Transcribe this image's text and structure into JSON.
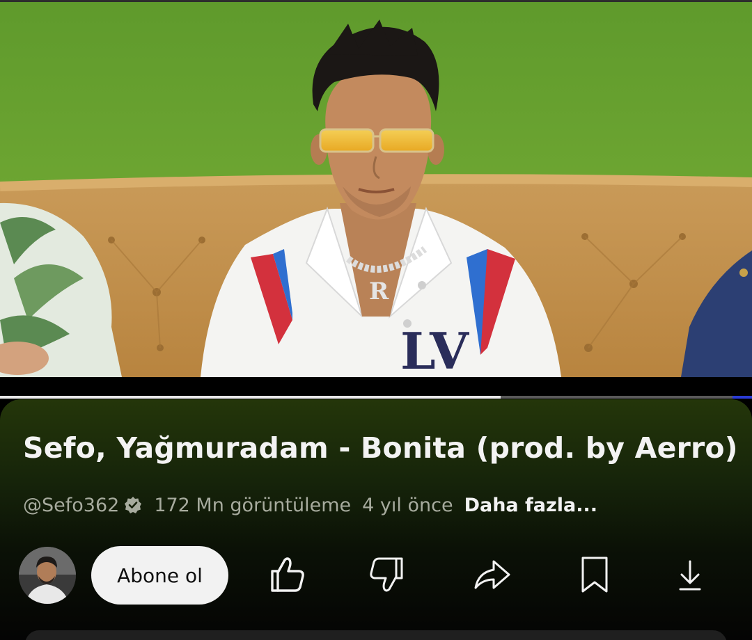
{
  "video": {
    "progress": 0.666
  },
  "title": "Sefo, Yağmuradam - Bonita (prod. by Aerro)",
  "meta": {
    "channel_handle": "@Sefo362",
    "views": "172 Mn görüntüleme",
    "age": "4 yıl önce",
    "more_label": "Daha fazla..."
  },
  "actions": {
    "subscribe_label": "Abone ol",
    "icons": [
      "like-icon",
      "dislike-icon",
      "share-icon",
      "save-icon",
      "download-icon"
    ]
  },
  "colors": {
    "panel_top": "#24360a",
    "text_primary": "#f3f3f3",
    "text_secondary": "#a7ab9e",
    "subscribe_bg": "#f2f2f2",
    "progress_fill": "#e8e8e8",
    "progress_end": "#2a3bd6"
  }
}
